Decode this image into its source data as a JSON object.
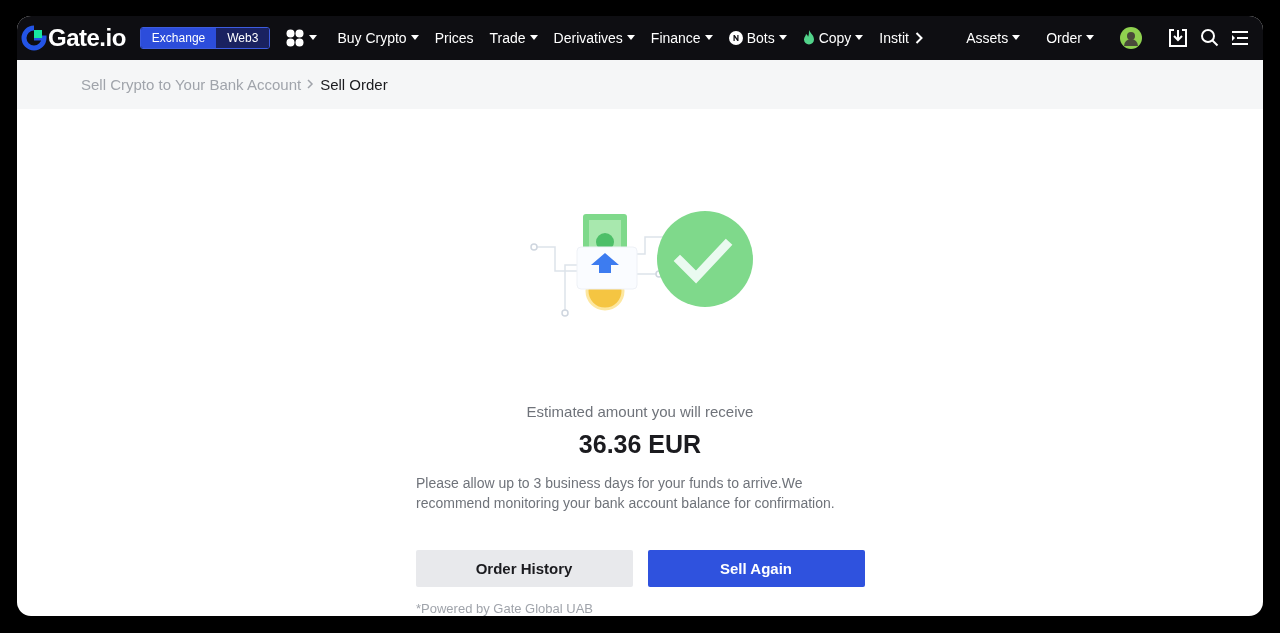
{
  "logo": {
    "text": "Gate.io"
  },
  "mode_switch": [
    {
      "label": "Exchange",
      "selected": true
    },
    {
      "label": "Web3",
      "selected": false
    }
  ],
  "nav": [
    {
      "label": "Buy Crypto",
      "kind": "plain",
      "dropdown": true
    },
    {
      "label": "Prices",
      "kind": "plain",
      "dropdown": false
    },
    {
      "label": "Trade",
      "kind": "plain",
      "dropdown": true
    },
    {
      "label": "Derivatives",
      "kind": "plain",
      "dropdown": true
    },
    {
      "label": "Finance",
      "kind": "plain",
      "dropdown": true
    },
    {
      "label": "Bots",
      "kind": "bots",
      "dropdown": true
    },
    {
      "label": "Copy",
      "kind": "copy",
      "dropdown": true
    },
    {
      "label": "Instit",
      "kind": "plain",
      "dropdown": false
    }
  ],
  "nav_right": [
    {
      "label": "Assets",
      "dropdown": true
    },
    {
      "label": "Order",
      "dropdown": true
    }
  ],
  "breadcrumb": [
    {
      "label": "Sell Crypto to Your Bank Account",
      "selected": false
    },
    {
      "label": "Sell Order",
      "selected": true
    }
  ],
  "result": {
    "caption": "Estimated amount you will receive",
    "amount": "36.36 EUR",
    "note": "Please allow up to 3 business days for your funds to arrive.We recommend monitoring your bank account balance for confirmation.",
    "buttons": [
      {
        "label": "Order History",
        "kind": "secondary"
      },
      {
        "label": "Sell Again",
        "kind": "primary"
      }
    ],
    "footnote": "*Powered by Gate Global UAB"
  }
}
